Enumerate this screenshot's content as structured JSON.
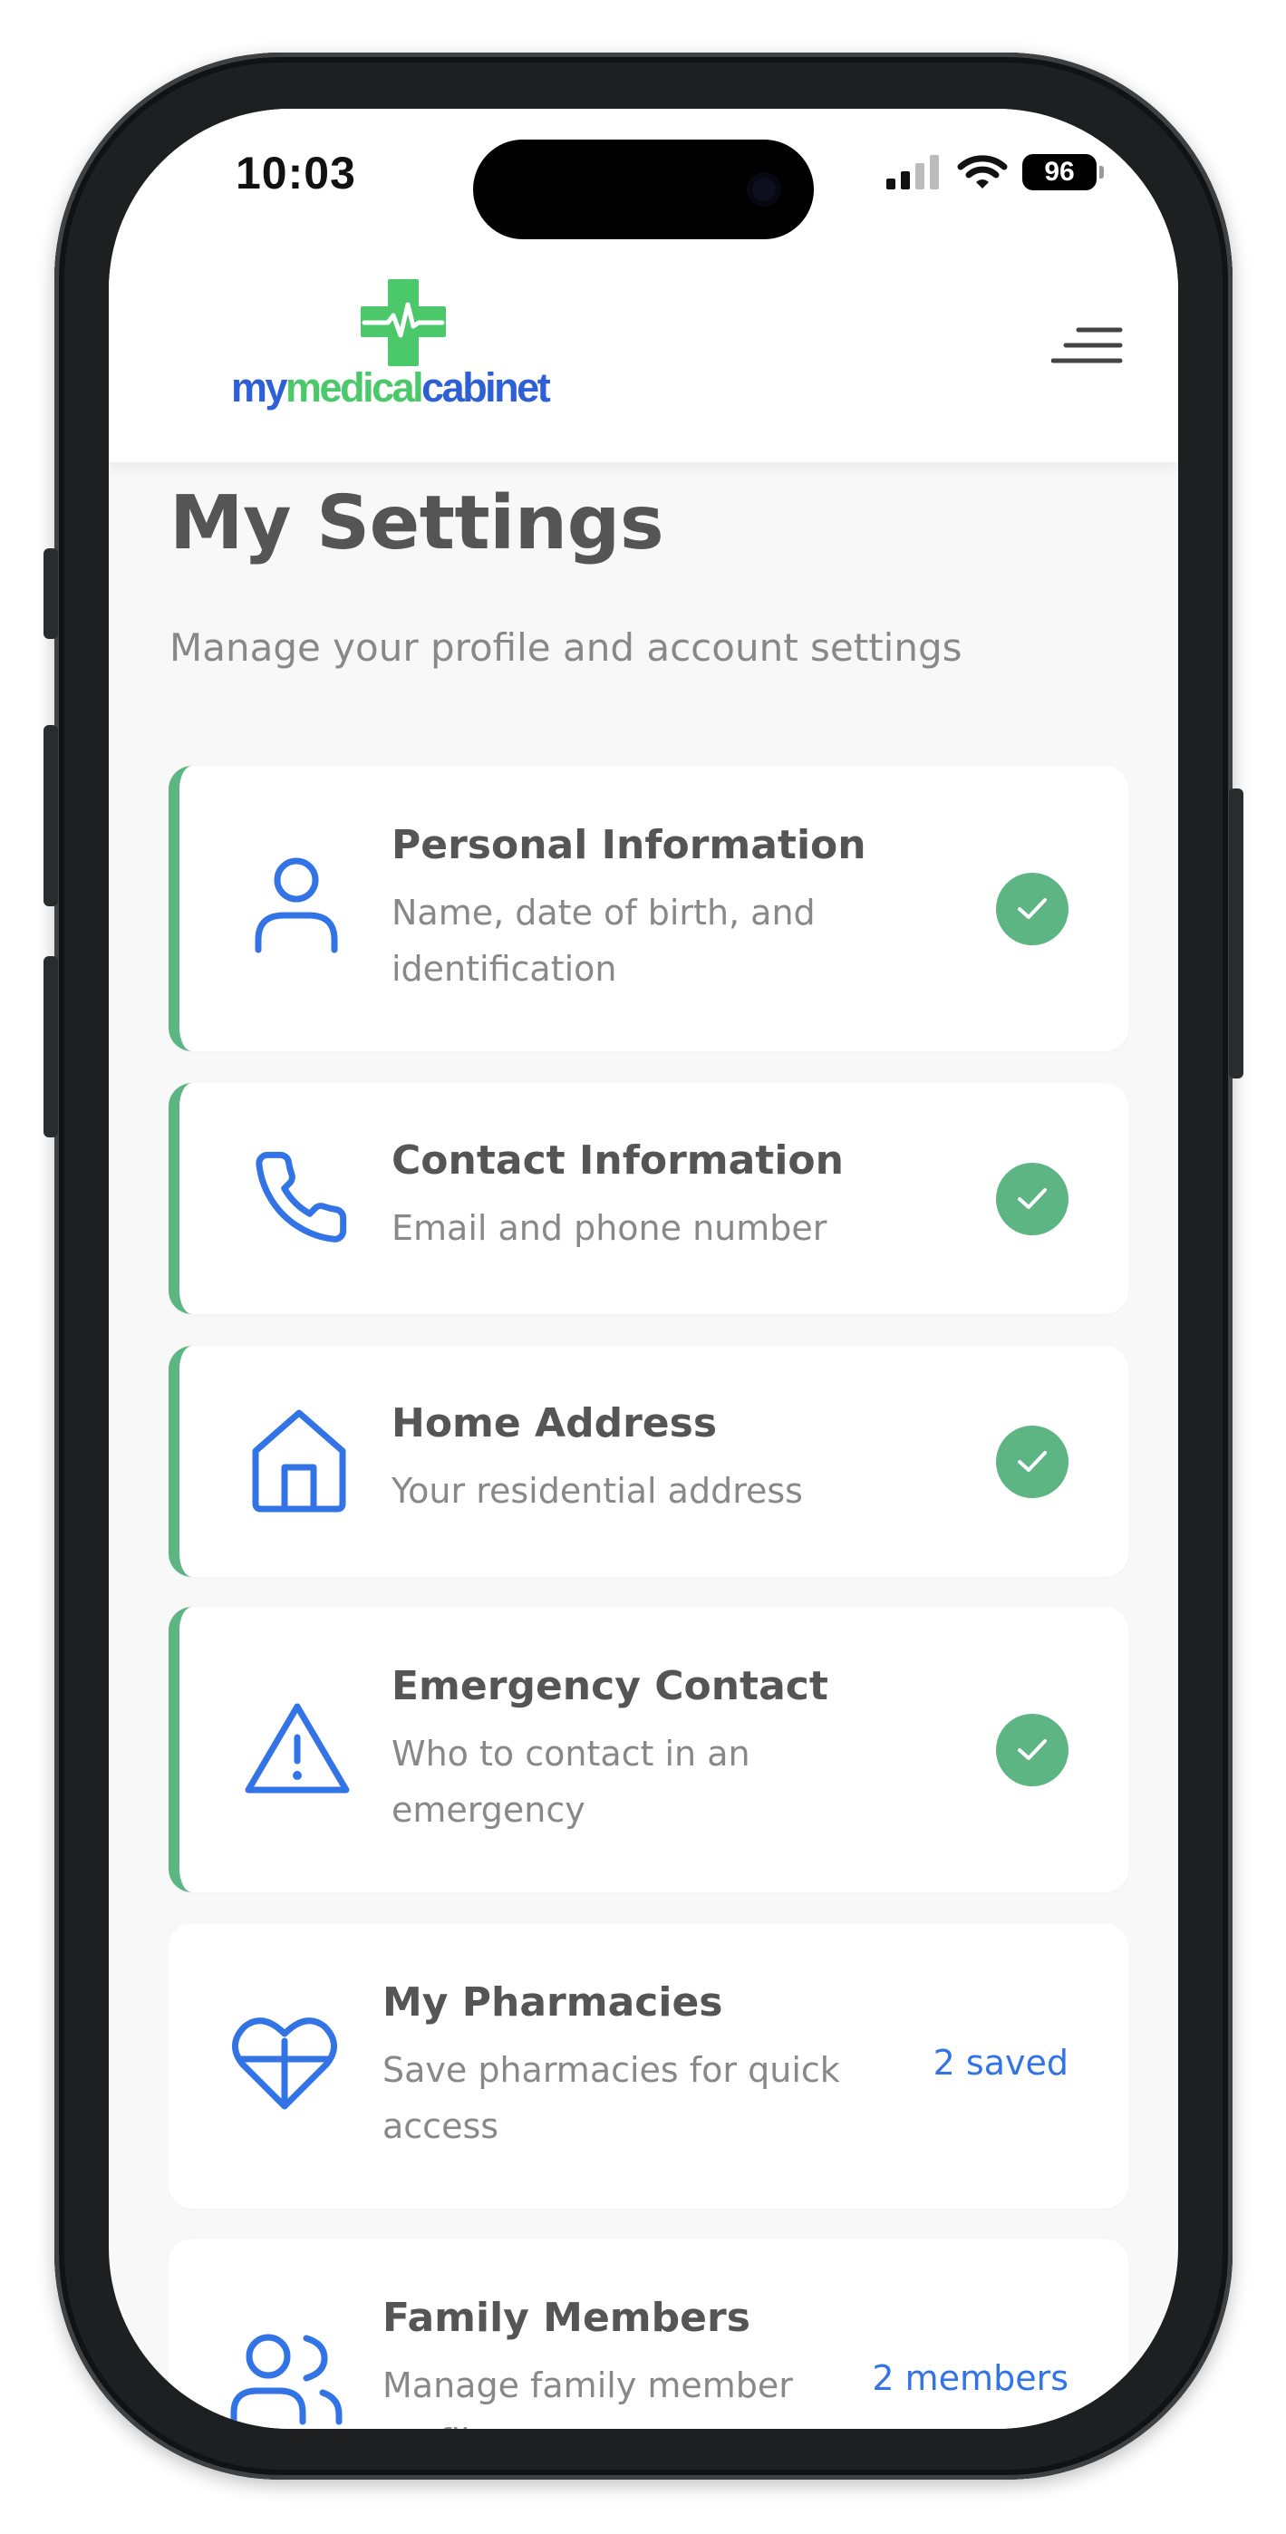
{
  "status_bar": {
    "time": "10:03",
    "battery": "96"
  },
  "header": {
    "logo": {
      "parts": [
        "my",
        "medical",
        "cabinet"
      ]
    },
    "menu_icon": "hamburger-menu-icon"
  },
  "page": {
    "title": "My Settings",
    "subtitle": "Manage your profile and account settings"
  },
  "settings": [
    {
      "title": "Personal Information",
      "description": "Name, date of birth, and identification",
      "icon": "user-icon",
      "complete": true
    },
    {
      "title": "Contact Information",
      "description": "Email and phone number",
      "icon": "phone-icon",
      "complete": true
    },
    {
      "title": "Home Address",
      "description": "Your residential address",
      "icon": "home-icon",
      "complete": true
    },
    {
      "title": "Emergency Contact",
      "description": "Who to contact in an emergency",
      "icon": "warning-icon",
      "complete": true
    },
    {
      "title": "My Pharmacies",
      "description": "Save pharmacies for quick access",
      "icon": "heart-plus-icon",
      "status": "2 saved"
    },
    {
      "title": "Family Members",
      "description": "Manage family member profiles",
      "icon": "users-icon",
      "status": "2 members"
    }
  ],
  "colors": {
    "accent_blue": "#3273e6",
    "success_green": "#5cb583",
    "logo_blue": "#2d5fd6",
    "logo_green": "#4bc96a"
  }
}
